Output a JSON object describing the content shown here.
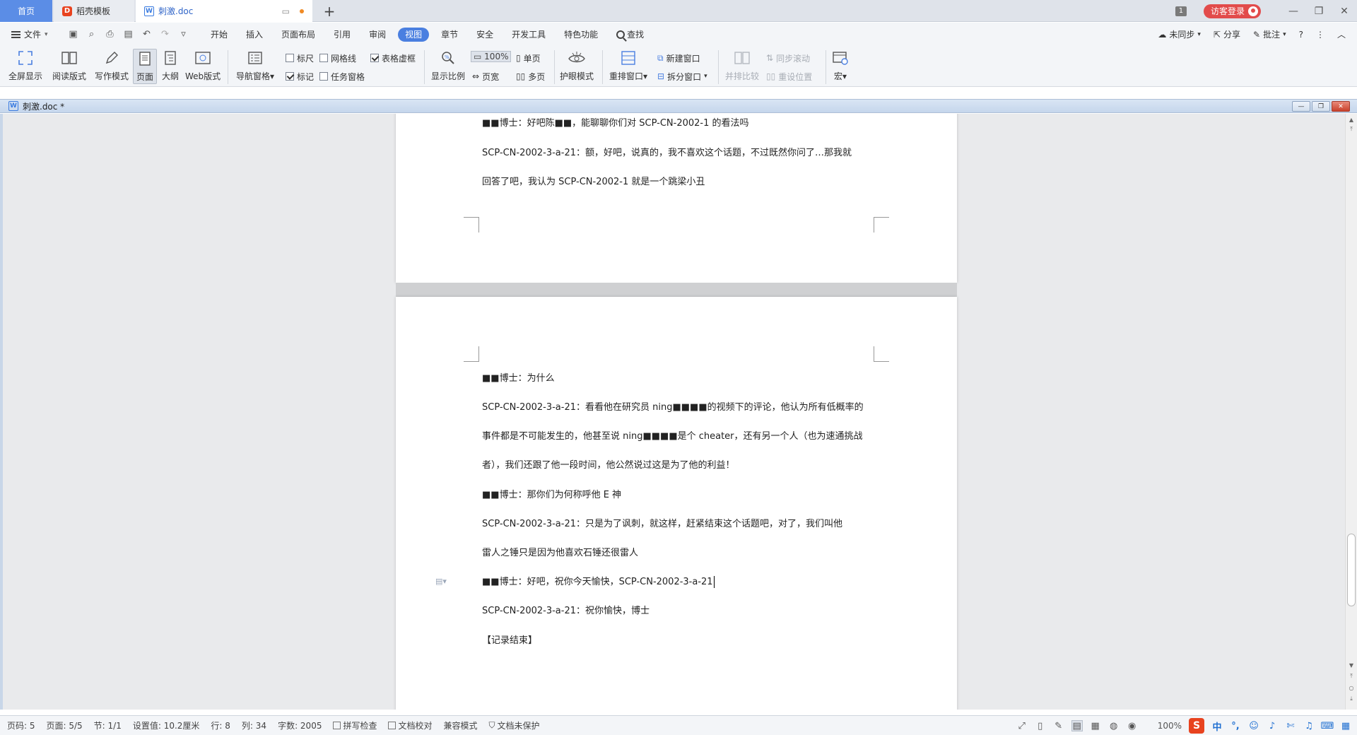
{
  "tabs": {
    "home": "首页",
    "template": "稻壳模板",
    "doc": "刺激.doc"
  },
  "titlebar": {
    "window_count": "1",
    "login": "访客登录"
  },
  "menu": {
    "file": "文件",
    "items": [
      "开始",
      "插入",
      "页面布局",
      "引用",
      "审阅",
      "视图",
      "章节",
      "安全",
      "开发工具",
      "特色功能"
    ],
    "active_index": 5,
    "search": "查找",
    "sync": "未同步",
    "share": "分享",
    "comment": "批注"
  },
  "ribbon": {
    "fullscreen": "全屏显示",
    "read_mode": "阅读版式",
    "write_mode": "写作模式",
    "page": "页面",
    "outline": "大纲",
    "web": "Web版式",
    "nav_pane": "导航窗格",
    "ruler": "标尺",
    "gridlines": "网格线",
    "table_gridlines": "表格虚框",
    "marks": "标记",
    "task_pane": "任务窗格",
    "zoom_ratio": "显示比例",
    "zoom_value": "100%",
    "single_page": "单页",
    "page_width": "页宽",
    "multi_page": "多页",
    "eye_mode": "护眼模式",
    "arrange": "重排窗口",
    "new_window": "新建窗口",
    "split_window": "拆分窗口",
    "side_by_side": "并排比较",
    "sync_scroll": "同步滚动",
    "reset_position": "重设位置",
    "macro": "宏"
  },
  "docwindow": {
    "title": "刺激.doc *"
  },
  "document": {
    "page1_lines": [
      "■■博士：好吧陈■■，能聊聊你们对 SCP-CN-2002-1 的看法吗",
      "SCP-CN-2002-3-a-21：额，好吧，说真的，我不喜欢这个话题，不过既然你问了…那我就",
      "回答了吧，我认为 SCP-CN-2002-1 就是一个跳梁小丑"
    ],
    "page2_lines": [
      "■■博士：为什么",
      "SCP-CN-2002-3-a-21：看看他在研究员 ning■■■■的视频下的评论，他认为所有低概率的",
      "事件都是不可能发生的，他甚至说 ning■■■■是个 cheater，还有另一个人（也为速通挑战",
      "者），我们还跟了他一段时间，他公然说过这是为了他的利益！",
      "■■博士：那你们为何称呼他 E 神",
      "SCP-CN-2002-3-a-21：只是为了讽刺，就这样，赶紧结束这个话题吧，对了，我们叫他",
      "雷人之锤只是因为他喜欢石锤还很雷人",
      "■■博士：好吧，祝你今天愉快，SCP-CN-2002-3-a-21",
      "SCP-CN-2002-3-a-21：祝你愉快，博士",
      "【记录结束】"
    ]
  },
  "status": {
    "page_no": "页码: 5",
    "pages": "页面: 5/5",
    "section": "节: 1/1",
    "setting": "设置值: 10.2厘米",
    "row": "行: 8",
    "col": "列: 34",
    "words": "字数: 2005",
    "spell": "拼写检查",
    "proof": "文档校对",
    "compat": "兼容模式",
    "protect": "文档未保护",
    "zoom": "100%",
    "ime": "中"
  },
  "colors": {
    "accent": "#4a7fe0",
    "home_tab": "#5b8de6",
    "login": "#e24b4b"
  }
}
